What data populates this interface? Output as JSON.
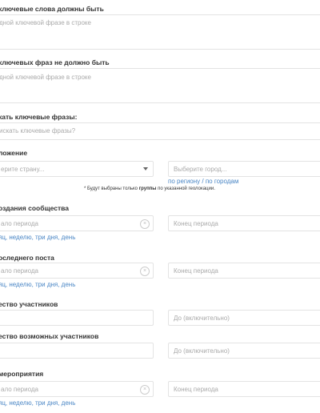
{
  "filters": {
    "keywords_required": {
      "label": "ключевые слова должны быть",
      "placeholder": "дной ключевой фразе в строке"
    },
    "keywords_excluded": {
      "label": "ключевых фраз не должно быть",
      "placeholder": "дной ключевой фразе в строке"
    },
    "search_phrases": {
      "label": "кать ключевые фразы:",
      "placeholder": "искать ключевые фразы?"
    },
    "location": {
      "label": "ложение",
      "country_placeholder": "ерите страну...",
      "city_placeholder": "Выберите город...",
      "link_region": "по региону",
      "link_sep": " / ",
      "link_cities": "по городам",
      "note_prefix": "* Будут выбраны только ",
      "note_bold": "группы",
      "note_suffix": " по указанной геолокации."
    },
    "created": {
      "label": "оздания сообщества",
      "start_placeholder": "ало периода",
      "end_placeholder": "Конец периода",
      "quick": "яц, неделю, три дня, день"
    },
    "last_post": {
      "label": "оследнего поста",
      "start_placeholder": "ало периода",
      "end_placeholder": "Конец периода",
      "quick": "яц, неделю, три дня, день"
    },
    "members": {
      "label": "ество участников",
      "to_placeholder": "До (включительно)"
    },
    "possible_members": {
      "label": "ество возможных участников",
      "to_placeholder": "До (включительно)"
    },
    "event": {
      "label": "мероприятия",
      "start_placeholder": "ало периода",
      "end_placeholder": "Конец периода",
      "quick": "яц, неделю, три дня, день"
    }
  }
}
